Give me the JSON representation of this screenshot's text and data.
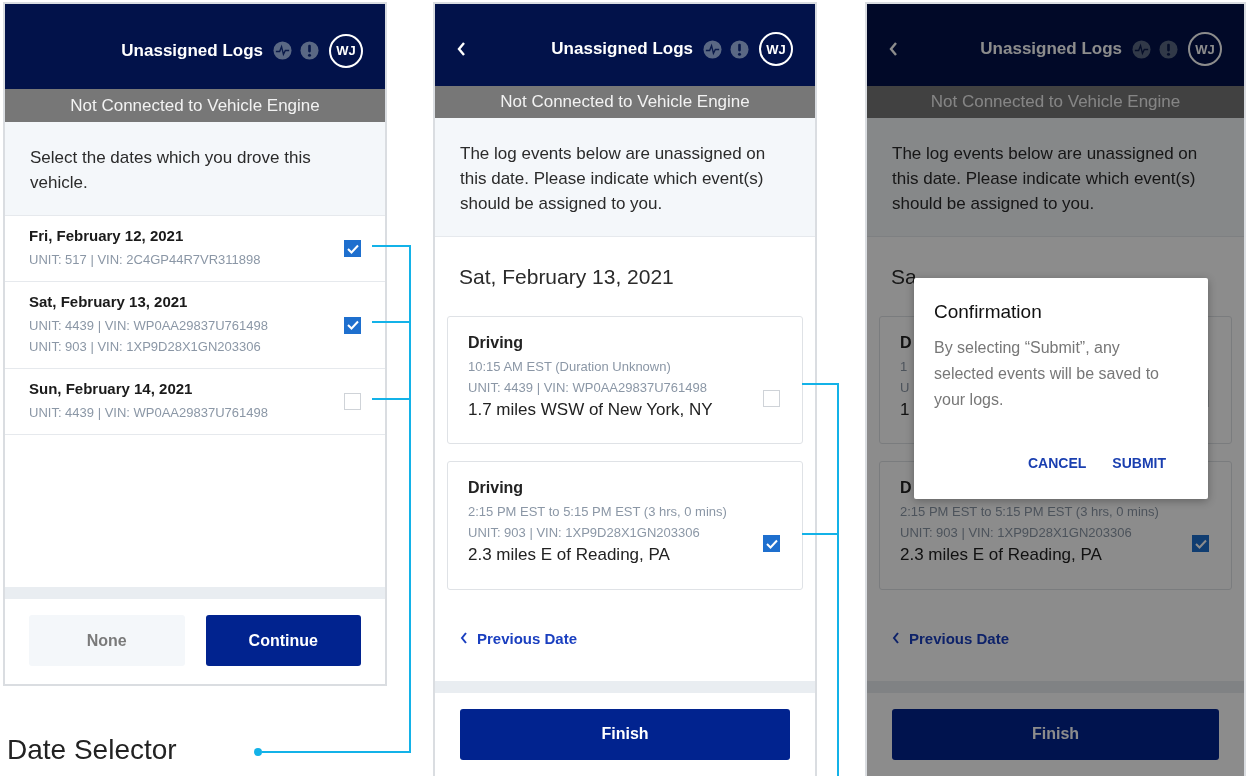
{
  "screens": [
    {
      "kind": "date_selector",
      "dimmed": false,
      "header": {
        "back": false,
        "title": "Unassigned Logs",
        "avatar": "WJ"
      },
      "banner": "Not Connected to Vehicle Engine",
      "intro": "Select the dates which you drove this vehicle.",
      "dates": [
        {
          "date": "Fri, February 12, 2021",
          "units": [
            "UNIT: 517 | VIN: 2C4GP44R7VR311898"
          ],
          "checked": true
        },
        {
          "date": "Sat, February 13, 2021",
          "units": [
            "UNIT: 4439 | VIN: WP0AA29837U761498",
            "UNIT: 903 | VIN: 1XP9D28X1GN203306"
          ],
          "checked": true
        },
        {
          "date": "Sun, February 14, 2021",
          "units": [
            "UNIT: 4439 | VIN: WP0AA29837U761498"
          ],
          "checked": false
        }
      ],
      "buttons": [
        {
          "label": "None",
          "kind": "secondary"
        },
        {
          "label": "Continue",
          "kind": "primary"
        }
      ]
    },
    {
      "kind": "events",
      "dimmed": false,
      "header": {
        "back": true,
        "title": "Unassigned Logs",
        "avatar": "WJ"
      },
      "banner": "Not Connected to Vehicle Engine",
      "intro": "The log events below are unassigned on this date. Please indicate which event(s) should be assigned to you.",
      "date_heading": "Sat, February 13, 2021",
      "events": [
        {
          "title": "Driving",
          "time": "10:15 AM EST (Duration Unknown)",
          "unit": "UNIT: 4439 | VIN: WP0AA29837U761498",
          "location": "1.7 miles WSW of New York, NY",
          "checked": false
        },
        {
          "title": "Driving",
          "time": "2:15 PM EST to 5:15 PM EST (3 hrs, 0 mins)",
          "unit": "UNIT: 903 | VIN: 1XP9D28X1GN203306",
          "location": "2.3 miles E of Reading, PA",
          "checked": true
        }
      ],
      "previous_link": "Previous Date",
      "finish_button": "Finish"
    },
    {
      "kind": "events",
      "dimmed": true,
      "header": {
        "back": true,
        "title": "Unassigned Logs",
        "avatar": "WJ"
      },
      "banner": "Not Connected to Vehicle Engine",
      "intro": "The log events below are unassigned on this date. Please indicate which event(s) should be assigned to you.",
      "date_heading": "Sa",
      "events": [
        {
          "title": "D",
          "time": "1",
          "unit": "U",
          "location": "1",
          "checked": false
        },
        {
          "title": "D",
          "time": "2:15 PM EST to 5:15 PM EST (3 hrs, 0 mins)",
          "unit": "UNIT: 903 | VIN: 1XP9D28X1GN203306",
          "location": "2.3 miles E of Reading, PA",
          "checked": true
        }
      ],
      "previous_link": "Previous Date",
      "finish_button": "Finish",
      "dialog": {
        "title": "Confirmation",
        "message": "By selecting “Submit”, any selected events will be saved to your logs.",
        "actions": [
          "CANCEL",
          "SUBMIT"
        ]
      }
    }
  ],
  "callouts": [
    {
      "label": "Date Selector"
    }
  ]
}
